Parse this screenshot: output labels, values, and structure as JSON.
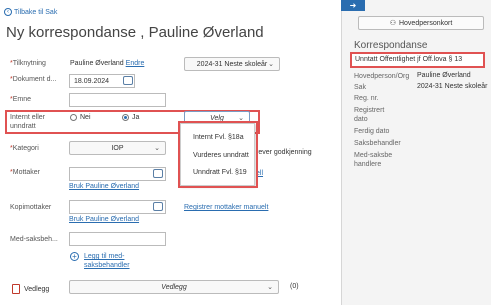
{
  "header": {
    "back_label": "Tilbake til Sak",
    "title": "Ny korrespondanse , Pauline Øverland"
  },
  "form": {
    "tilknytning_label": "Tilknytning",
    "tilknytning_value": "Pauline Øverland",
    "endre_label": "Endre",
    "skoleaar_value": "2024-31 Neste skoleår",
    "dokument_label": "Dokument d...",
    "dokument_value": "18.09.2024",
    "emne_label": "Emne",
    "internt_label": "Internt eller unndratt",
    "radio_nei": "Nei",
    "radio_ja": "Ja",
    "velg_value": "Velg",
    "kategori_label": "Kategori",
    "kategori_value": "IOP",
    "godkjenning_text": "rever godkjenning",
    "mottaker_label": "Mottaker",
    "mottaker_tail": "ell",
    "bruk_link_1": "Bruk Pauline Øverland",
    "kopimottaker_label": "Kopimottaker",
    "bruk_link_2": "Bruk Pauline Øverland",
    "registrer_link": "Registrer mottaker manuelt",
    "medsaks_label": "Med-saksbeh...",
    "legg_til_label": "Legg til med-saksbehandler",
    "vedlegg_label": "Vedlegg",
    "vedlegg_select": "Vedlegg",
    "vedlegg_count": "(0)"
  },
  "dropdown": {
    "items": [
      "Internt Fvl. §18a",
      "Vurderes unndratt",
      "Unndratt Fvl. §19"
    ]
  },
  "right_panel": {
    "tab_arrow": "➜",
    "hovedperson_label": "Hovedpersonkort",
    "title": "Korrespondanse",
    "unntatt_text": "Unntatt Offentlighet jf Off.lova § 13",
    "rows": [
      {
        "label": "Hovedperson/Org",
        "value": "Pauline Øverland"
      },
      {
        "label": "Sak",
        "value": "2024-31 Neste skoleår"
      },
      {
        "label": "Reg. nr.",
        "value": ""
      },
      {
        "label": "Registrert dato",
        "value": ""
      },
      {
        "label": "Ferdig dato",
        "value": ""
      },
      {
        "label": "Saksbehandler",
        "value": ""
      },
      {
        "label": "Med-saksbehandlere",
        "value": ""
      }
    ]
  },
  "colors": {
    "accent": "#2a6db0",
    "highlight_box": "#e05252"
  }
}
